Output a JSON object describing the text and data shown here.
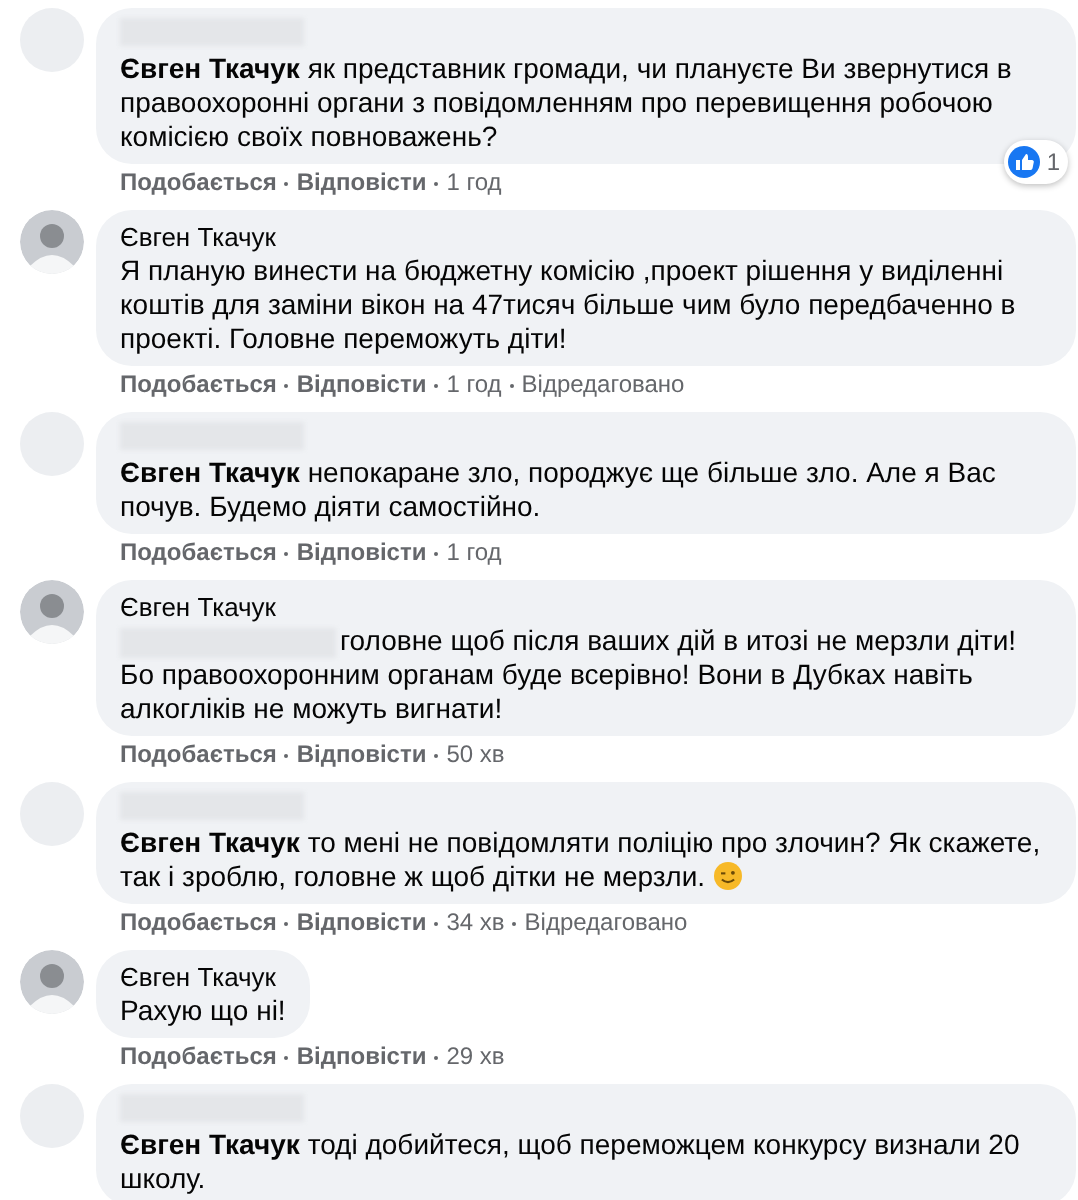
{
  "comments": [
    {
      "avatar": {
        "kind": "blank"
      },
      "author": {
        "redacted": true
      },
      "mention": "Євген Ткачук",
      "text": "як представник громади, чи плануєте Ви звернутися в правоохоронні органи з повідомленням про перевищення робочою комісією своїх повноважень?",
      "like": "Подобається",
      "reply": "Відповісти",
      "time": "1 год",
      "reactions": "1"
    },
    {
      "avatar": {
        "kind": "photo"
      },
      "author": {
        "redacted": false,
        "name": "Євген Ткачук"
      },
      "text": "Я планую винести на бюджетну комісію ,проект рішення у виділенні коштів для заміни вікон на 47тисяч більше чим було передбаченно в проекті. Головне переможуть діти!",
      "like": "Подобається",
      "reply": "Відповісти",
      "time": "1 год",
      "edited": "Відредаговано"
    },
    {
      "avatar": {
        "kind": "blank"
      },
      "author": {
        "redacted": true
      },
      "mention": "Євген Ткачук",
      "text": "непокаране зло, породжує ще більше зло. Але я Вас почув. Будемо діяти самостійно.",
      "like": "Подобається",
      "reply": "Відповісти",
      "time": "1 год"
    },
    {
      "avatar": {
        "kind": "photo"
      },
      "author": {
        "redacted": false,
        "name": "Євген Ткачук"
      },
      "redacted_prefix": true,
      "text": "головне щоб після ваших дій в итозі не мерзли діти! Бо правоохоронним органам буде всерівно! Вони в Дубках навіть алкогліків не можуть вигнати!",
      "like": "Подобається",
      "reply": "Відповісти",
      "time": "50 хв"
    },
    {
      "avatar": {
        "kind": "blank"
      },
      "author": {
        "redacted": true
      },
      "mention": "Євген Ткачук",
      "text": "то мені не повідомляти поліцію про злочин? Як скажете, так і зроблю, головне ж щоб дітки не мерзли.",
      "emoji": true,
      "like": "Подобається",
      "reply": "Відповісти",
      "time": "34 хв",
      "edited": "Відредаговано"
    },
    {
      "avatar": {
        "kind": "photo"
      },
      "author": {
        "redacted": false,
        "name": "Євген Ткачук"
      },
      "text": "Рахую що ні!",
      "like": "Подобається",
      "reply": "Відповісти",
      "time": "29 хв"
    },
    {
      "avatar": {
        "kind": "blank"
      },
      "author": {
        "redacted": true
      },
      "mention": "Євген Ткачук",
      "text": "тоді добийтеся, щоб переможцем конкурсу визнали 20 школу."
    }
  ]
}
